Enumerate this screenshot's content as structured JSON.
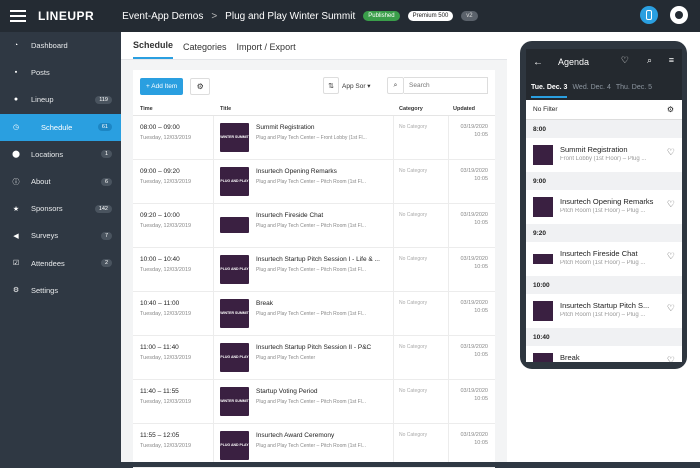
{
  "topbar": {
    "logo": "LINEUPR",
    "breadcrumb_1": "Event-App Demos",
    "breadcrumb_sep": ">",
    "breadcrumb_2": "Plug and Play Winter Summit",
    "badge_status": "Published",
    "badge_plan": "Premium 500",
    "badge_version": "v2"
  },
  "sidebar": {
    "items": [
      {
        "label": "Dashboard",
        "icon": "gauge-icon",
        "count": ""
      },
      {
        "label": "Posts",
        "icon": "chat-icon",
        "count": ""
      },
      {
        "label": "Lineup",
        "icon": "person-icon",
        "count": "119"
      },
      {
        "label": "Schedule",
        "icon": "clock-icon",
        "count": "61"
      },
      {
        "label": "Locations",
        "icon": "pin-icon",
        "count": "1"
      },
      {
        "label": "About",
        "icon": "info-icon",
        "count": "6"
      },
      {
        "label": "Sponsors",
        "icon": "star-icon",
        "count": "142"
      },
      {
        "label": "Surveys",
        "icon": "megaphone-icon",
        "count": "7"
      },
      {
        "label": "Attendees",
        "icon": "checkbox-icon",
        "count": "2"
      },
      {
        "label": "Settings",
        "icon": "gear-icon",
        "count": ""
      }
    ],
    "active_index": 3
  },
  "tabs": [
    "Schedule",
    "Categories",
    "Import / Export"
  ],
  "toolbar": {
    "add_label": "+ Add Item",
    "sort_label": "App Sor ▾",
    "search_placeholder": "Search"
  },
  "table": {
    "headers": [
      "Time",
      "Title",
      "Category",
      "Updated"
    ],
    "rows": [
      {
        "time": "08:00 – 09:00",
        "date": "Tuesday, 12/03/2019",
        "title": "Summit Registration",
        "loc": "Plug and Play Tech Center – Front Lobby (1st Fl...",
        "cat": "No Category",
        "upd1": "03/19/2020",
        "upd2": "10:05",
        "thumb": "WINTER SUMMIT"
      },
      {
        "time": "09:00 – 09:20",
        "date": "Tuesday, 12/03/2019",
        "title": "Insurtech Opening Remarks",
        "loc": "Plug and Play Tech Center – Pitch Room (1st Fl...",
        "cat": "No Category",
        "upd1": "03/19/2020",
        "upd2": "10:05",
        "thumb": "PLUG AND PLAY"
      },
      {
        "time": "09:20 – 10:00",
        "date": "Tuesday, 12/03/2019",
        "title": "Insurtech Fireside Chat",
        "loc": "Plug and Play Tech Center – Pitch Room (1st Fl...",
        "cat": "No Category",
        "upd1": "03/19/2020",
        "upd2": "10:05",
        "thumb": ""
      },
      {
        "time": "10:00 – 10:40",
        "date": "Tuesday, 12/03/2019",
        "title": "Insurtech Startup Pitch Session I - Life & ...",
        "loc": "Plug and Play Tech Center – Pitch Room (1st Fl...",
        "cat": "No Category",
        "upd1": "03/19/2020",
        "upd2": "10:05",
        "thumb": "PLUG AND PLAY"
      },
      {
        "time": "10:40 – 11:00",
        "date": "Tuesday, 12/03/2019",
        "title": "Break",
        "loc": "Plug and Play Tech Center – Pitch Room (1st Fl...",
        "cat": "No Category",
        "upd1": "03/19/2020",
        "upd2": "10:05",
        "thumb": "WINTER SUMMIT"
      },
      {
        "time": "11:00 – 11:40",
        "date": "Tuesday, 12/03/2019",
        "title": "Insurtech Startup Pitch Session II - P&C",
        "loc": "Plug and Play Tech Center",
        "cat": "No Category",
        "upd1": "03/19/2020",
        "upd2": "10:05",
        "thumb": "PLUG AND PLAY"
      },
      {
        "time": "11:40 – 11:55",
        "date": "Tuesday, 12/03/2019",
        "title": "Startup Voting Period",
        "loc": "Plug and Play Tech Center – Pitch Room (1st Fl...",
        "cat": "No Category",
        "upd1": "03/19/2020",
        "upd2": "10:05",
        "thumb": "WINTER SUMMIT"
      },
      {
        "time": "11:55 – 12:05",
        "date": "Tuesday, 12/03/2019",
        "title": "Insurtech Award Ceremony",
        "loc": "Plug and Play Tech Center – Pitch Room (1st Fl...",
        "cat": "No Category",
        "upd1": "03/19/2020",
        "upd2": "10:05",
        "thumb": "PLUG AND PLAY"
      }
    ]
  },
  "phone": {
    "title": "Agenda",
    "days": [
      "Tue. Dec. 3",
      "Wed. Dec. 4",
      "Thu. Dec. 5"
    ],
    "filter": "No Filter",
    "slots": [
      {
        "time": "8:00",
        "title": "Summit Registration",
        "loc": "Front Lobby (1st Floor) – Plug ..."
      },
      {
        "time": "9:00",
        "title": "Insurtech Opening Remarks",
        "loc": "Pitch Room (1st Floor) – Plug ..."
      },
      {
        "time": "9:20",
        "title": "Insurtech Fireside Chat",
        "loc": "Pitch Room (1st Floor) – Plug ..."
      },
      {
        "time": "10:00",
        "title": "Insurtech Startup Pitch S...",
        "loc": "Pitch Room (1st Floor) – Plug ..."
      },
      {
        "time": "10:40",
        "title": "Break",
        "loc": ""
      }
    ]
  },
  "colors": {
    "accent": "#2a9fe0",
    "sidebar": "#2f3843",
    "topbar": "#242b33",
    "thumb": "#3a2041"
  }
}
